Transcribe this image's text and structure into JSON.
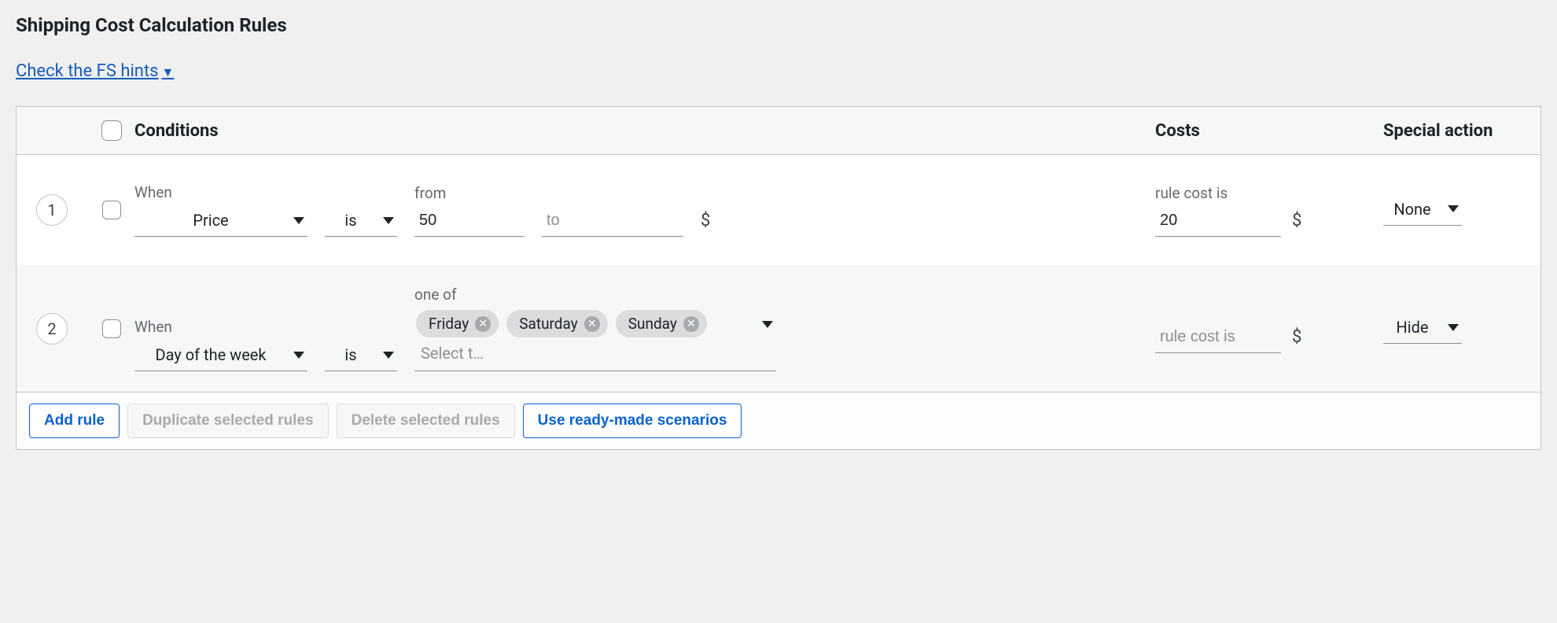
{
  "title": "Shipping Cost Calculation Rules",
  "hints_link": "Check the FS hints",
  "columns": {
    "conditions": "Conditions",
    "costs": "Costs",
    "special": "Special action"
  },
  "labels": {
    "when": "When",
    "from": "from",
    "to": "to",
    "one_of": "one of",
    "rule_cost": "rule cost is",
    "select_placeholder": "Select t…"
  },
  "currency": "$",
  "rules": [
    {
      "index": "1",
      "when": "Price",
      "op": "is",
      "from": "50",
      "to_value": "",
      "cost": "20",
      "special": "None"
    },
    {
      "index": "2",
      "when": "Day of the week",
      "op": "is",
      "tags": [
        "Friday",
        "Saturday",
        "Sunday"
      ],
      "cost_placeholder": "rule cost is",
      "special": "Hide"
    }
  ],
  "buttons": {
    "add": "Add rule",
    "duplicate": "Duplicate selected rules",
    "delete": "Delete selected rules",
    "scenarios": "Use ready-made scenarios"
  }
}
